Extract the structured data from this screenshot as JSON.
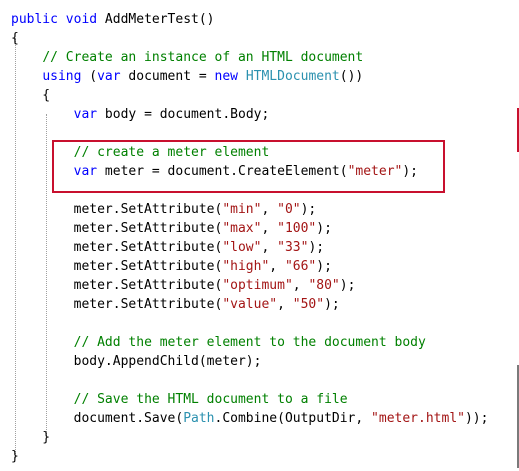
{
  "code": {
    "lines": [
      [
        {
          "t": "public",
          "c": "k"
        },
        {
          "t": " "
        },
        {
          "t": "void",
          "c": "k"
        },
        {
          "t": " AddMeterTest()"
        }
      ],
      [
        {
          "t": "{"
        }
      ],
      [
        {
          "t": "    "
        },
        {
          "t": "// Create an instance of an HTML document",
          "c": "c"
        }
      ],
      [
        {
          "t": "    "
        },
        {
          "t": "using",
          "c": "k"
        },
        {
          "t": " ("
        },
        {
          "t": "var",
          "c": "k"
        },
        {
          "t": " document = "
        },
        {
          "t": "new",
          "c": "k"
        },
        {
          "t": " "
        },
        {
          "t": "HTMLDocument",
          "c": "t"
        },
        {
          "t": "())"
        }
      ],
      [
        {
          "t": "    {"
        }
      ],
      [
        {
          "t": "        "
        },
        {
          "t": "var",
          "c": "k"
        },
        {
          "t": " body = document.Body;"
        }
      ],
      [],
      [
        {
          "t": "        "
        },
        {
          "t": "// create a meter element",
          "c": "c"
        }
      ],
      [
        {
          "t": "        "
        },
        {
          "t": "var",
          "c": "k"
        },
        {
          "t": " meter = document.CreateElement("
        },
        {
          "t": "\"meter\"",
          "c": "s"
        },
        {
          "t": ");"
        }
      ],
      [],
      [
        {
          "t": "        meter.SetAttribute("
        },
        {
          "t": "\"min\"",
          "c": "s"
        },
        {
          "t": ", "
        },
        {
          "t": "\"0\"",
          "c": "s"
        },
        {
          "t": ");"
        }
      ],
      [
        {
          "t": "        meter.SetAttribute("
        },
        {
          "t": "\"max\"",
          "c": "s"
        },
        {
          "t": ", "
        },
        {
          "t": "\"100\"",
          "c": "s"
        },
        {
          "t": ");"
        }
      ],
      [
        {
          "t": "        meter.SetAttribute("
        },
        {
          "t": "\"low\"",
          "c": "s"
        },
        {
          "t": ", "
        },
        {
          "t": "\"33\"",
          "c": "s"
        },
        {
          "t": ");"
        }
      ],
      [
        {
          "t": "        meter.SetAttribute("
        },
        {
          "t": "\"high\"",
          "c": "s"
        },
        {
          "t": ", "
        },
        {
          "t": "\"66\"",
          "c": "s"
        },
        {
          "t": ");"
        }
      ],
      [
        {
          "t": "        meter.SetAttribute("
        },
        {
          "t": "\"optimum\"",
          "c": "s"
        },
        {
          "t": ", "
        },
        {
          "t": "\"80\"",
          "c": "s"
        },
        {
          "t": ");"
        }
      ],
      [
        {
          "t": "        meter.SetAttribute("
        },
        {
          "t": "\"value\"",
          "c": "s"
        },
        {
          "t": ", "
        },
        {
          "t": "\"50\"",
          "c": "s"
        },
        {
          "t": ");"
        }
      ],
      [],
      [
        {
          "t": "        "
        },
        {
          "t": "// Add the meter element to the document body",
          "c": "c"
        }
      ],
      [
        {
          "t": "        body.AppendChild(meter);"
        }
      ],
      [],
      [
        {
          "t": "        "
        },
        {
          "t": "// Save the HTML document to a file",
          "c": "c"
        }
      ],
      [
        {
          "t": "        document.Save("
        },
        {
          "t": "Path",
          "c": "t"
        },
        {
          "t": ".Combine(OutputDir, "
        },
        {
          "t": "\"meter.html\"",
          "c": "s"
        },
        {
          "t": "));"
        }
      ],
      [
        {
          "t": "    }"
        }
      ],
      [
        {
          "t": "}"
        }
      ]
    ]
  },
  "colors": {
    "keyword": "#0000ff",
    "comment": "#008000",
    "string": "#a31515",
    "type": "#2b91af",
    "highlight_border": "#c8102e",
    "scroll_marker_red": "#c8102e",
    "scroll_marker_gray": "#7a7a7a"
  }
}
